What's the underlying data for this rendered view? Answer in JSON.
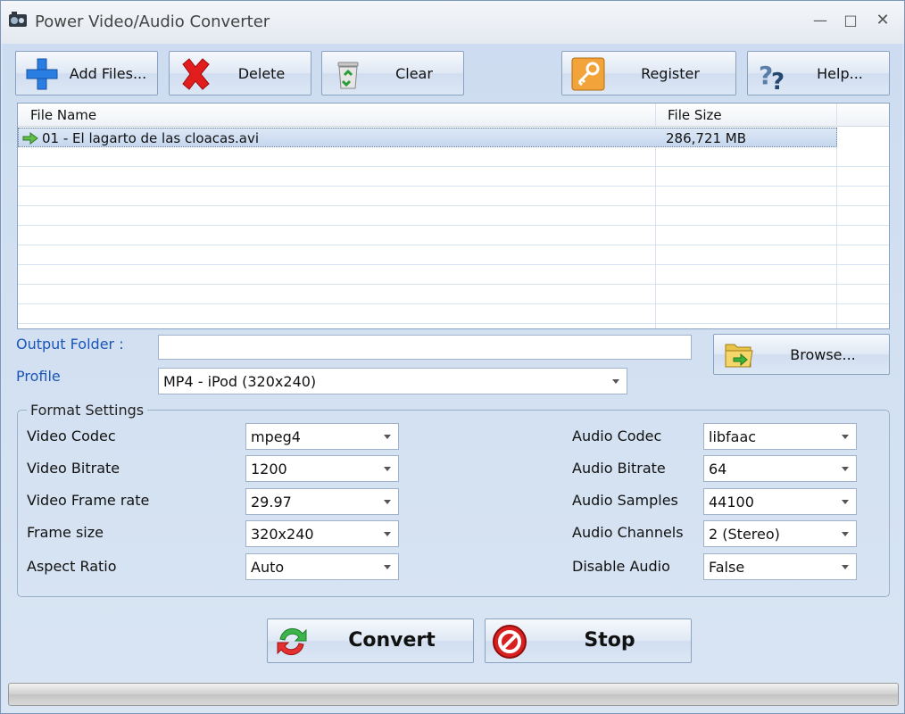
{
  "window": {
    "title": "Power Video/Audio Converter"
  },
  "toolbar": {
    "add_files": "Add Files...",
    "delete": "Delete",
    "clear": "Clear",
    "register": "Register",
    "help": "Help..."
  },
  "file_list": {
    "columns": [
      "File Name",
      "File Size"
    ],
    "rows": [
      {
        "name": "01 - El lagarto de las cloacas.avi",
        "size": "286,721 MB"
      }
    ]
  },
  "output": {
    "folder_label": "Output Folder :",
    "folder_value": "",
    "browse": "Browse...",
    "profile_label": "Profile",
    "profile_value": "MP4 - iPod (320x240)"
  },
  "format_settings": {
    "title": "Format Settings",
    "video_codec_label": "Video Codec",
    "video_codec": "mpeg4",
    "video_bitrate_label": "Video Bitrate",
    "video_bitrate": "1200",
    "video_frame_rate_label": "Video Frame rate",
    "video_frame_rate": "29.97",
    "frame_size_label": "Frame size",
    "frame_size": "320x240",
    "aspect_ratio_label": "Aspect Ratio",
    "aspect_ratio": "Auto",
    "audio_codec_label": "Audio Codec",
    "audio_codec": "libfaac",
    "audio_bitrate_label": "Audio Bitrate",
    "audio_bitrate": "64",
    "audio_samples_label": "Audio Samples",
    "audio_samples": "44100",
    "audio_channels_label": "Audio Channels",
    "audio_channels": "2 (Stereo)",
    "disable_audio_label": "Disable Audio",
    "disable_audio": "False"
  },
  "actions": {
    "convert": "Convert",
    "stop": "Stop"
  },
  "progress": {
    "value": 0
  },
  "icons": {
    "add": "plus-icon",
    "delete": "x-icon",
    "clear": "recycle-bin-icon",
    "register": "key-icon",
    "help": "question-icon",
    "browse": "folder-icon",
    "convert": "refresh-icon",
    "stop": "stop-icon"
  }
}
